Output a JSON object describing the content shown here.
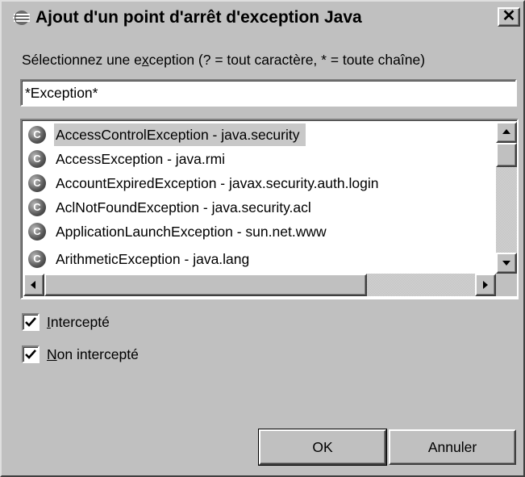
{
  "dialog": {
    "title": "Ajout d'un point d'arrêt d'exception Java",
    "close_label": "✕",
    "prompt_before": "Sélectionnez une e",
    "prompt_mnemonic": "x",
    "prompt_after": "ception (? = tout caractère, * = toute chaîne)",
    "filter_value": "*Exception*",
    "items": [
      {
        "icon": "C",
        "label": "AccessControlException - java.security",
        "selected": true
      },
      {
        "icon": "C",
        "label": "AccessException - java.rmi",
        "selected": false
      },
      {
        "icon": "C",
        "label": "AccountExpiredException - javax.security.auth.login",
        "selected": false
      },
      {
        "icon": "C",
        "label": "AclNotFoundException - java.security.acl",
        "selected": false
      },
      {
        "icon": "C",
        "label": "ApplicationLaunchException - sun.net.www",
        "selected": false
      },
      {
        "icon": "C",
        "label": "ArithmeticException - java.lang",
        "selected": false
      }
    ],
    "caught": {
      "mnemonic": "I",
      "rest": "ntercepté",
      "checked": true
    },
    "uncaught": {
      "mnemonic": "N",
      "rest": "on intercepté",
      "checked": true
    },
    "ok_label": "OK",
    "cancel_label": "Annuler"
  }
}
